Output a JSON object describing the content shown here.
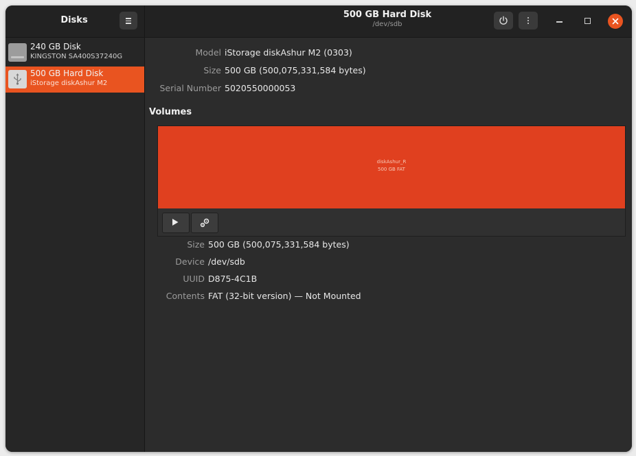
{
  "sidebar": {
    "title": "Disks",
    "disks": [
      {
        "name": "240 GB Disk",
        "model": "KINGSTON SA400S37240G",
        "icon": "hard-drive-icon",
        "selected": false
      },
      {
        "name": "500 GB Hard Disk",
        "model": "iStorage diskAshur M2",
        "icon": "usb-drive-icon",
        "selected": true
      }
    ]
  },
  "header": {
    "title": "500 GB Hard Disk",
    "subtitle": "/dev/sdb",
    "icons": [
      "menu-icon",
      "power-icon",
      "more-options-icon",
      "minimize-icon",
      "maximize-icon",
      "close-icon"
    ]
  },
  "drive_info": {
    "model_label": "Model",
    "model_value": "iStorage diskAshur M2 (0303)",
    "size_label": "Size",
    "size_value": "500 GB (500,075,331,584 bytes)",
    "serial_label": "Serial Number",
    "serial_value": "5020550000053"
  },
  "volumes": {
    "title": "Volumes",
    "partition": {
      "name": "diskAshur_R",
      "size": "500 GB FAT"
    },
    "toolbar": [
      "play-icon",
      "gears-icon"
    ]
  },
  "volume_info": {
    "size_label": "Size",
    "size_value": "500 GB (500,075,331,584 bytes)",
    "device_label": "Device",
    "device_value": "/dev/sdb",
    "uuid_label": "UUID",
    "uuid_value": "D875-4C1B",
    "contents_label": "Contents",
    "contents_value": "FAT (32-bit version) — Not Mounted"
  },
  "colors": {
    "accent": "#e95420",
    "partition": "#e0401f",
    "background": "#2c2c2c"
  }
}
